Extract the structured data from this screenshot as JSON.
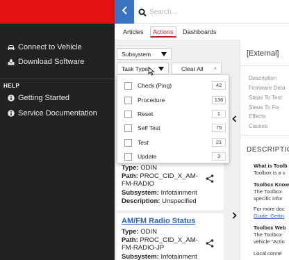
{
  "sidebar": {
    "items": [
      {
        "label": "Connect to Vehicle",
        "icon": "car-icon"
      },
      {
        "label": "Download Software",
        "icon": "download-icon"
      }
    ],
    "help_heading": "HELP",
    "help_items": [
      {
        "label": "Getting Started",
        "icon": "info-icon"
      },
      {
        "label": "Service Documentation",
        "icon": "info-icon"
      }
    ]
  },
  "search": {
    "placeholder": "Search..."
  },
  "tabs": [
    {
      "label": "Articles",
      "active": false
    },
    {
      "label": "Actions",
      "active": true
    },
    {
      "label": "Dashboards",
      "active": false
    }
  ],
  "filters": {
    "subsystem_label": "Subsystem",
    "task_type_label": "Task Type",
    "clear_all_label": "Clear All"
  },
  "task_type_options": [
    {
      "label": "Check (Ping)",
      "count": "42"
    },
    {
      "label": "Procedure",
      "count": "136"
    },
    {
      "label": "Reset",
      "count": "1"
    },
    {
      "label": "Self Test",
      "count": "75"
    },
    {
      "label": "Test",
      "count": "21"
    },
    {
      "label": "Update",
      "count": "3"
    }
  ],
  "results": [
    {
      "title": "",
      "type_label": "Type:",
      "type": "ODIN",
      "path_label": "Path:",
      "path": "PROC_CID_X_AM-FM-RADIO",
      "subsystem_label": "Subsystem:",
      "subsystem": "Infotainment",
      "description_label": "Description:",
      "description": "Unspecified"
    },
    {
      "title": "AM/FM Radio Status",
      "type_label": "Type:",
      "type": "ODIN",
      "path_label": "Path:",
      "path": "PROC_CID_X_AM-FM-RADIO-JP",
      "subsystem_label": "Subsystem:",
      "subsystem": "Infotainment"
    }
  ],
  "detail": {
    "title": "[External]",
    "nav_links": [
      "Description",
      "Firmware Deta",
      "Steps To Test",
      "Steps To Fix",
      "Effects",
      "Causes"
    ],
    "section_heading": "DESCRIPTIO",
    "desc_lines": [
      {
        "text": "What is Toolb",
        "style": "bold"
      },
      {
        "text": "Toolbox is a s",
        "style": "normal"
      },
      {
        "text": "Toolbox Know",
        "style": "bold"
      },
      {
        "text": "The Toolbox",
        "style": "normal"
      },
      {
        "text": "specific infor",
        "style": "normal"
      },
      {
        "text": "For more doc",
        "style": "normal"
      },
      {
        "text": "Guide: Gettin",
        "style": "link"
      },
      {
        "text": "Toolbox Web",
        "style": "bold"
      },
      {
        "text": "The Toolbox",
        "style": "normal"
      },
      {
        "text": "vehicle \"Actio",
        "style": "normal"
      },
      {
        "text": "Local conne",
        "style": "normal"
      }
    ]
  },
  "colors": {
    "brand_red": "#e31212",
    "sidebar_bg": "#222222",
    "accent_blue": "#3a72c2",
    "link_blue": "#2a63b3",
    "active_tab_red": "#c71f1f"
  }
}
